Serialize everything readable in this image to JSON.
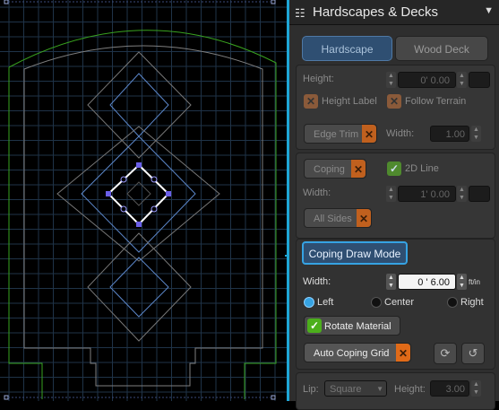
{
  "panel": {
    "title": "Hardscapes & Decks",
    "title_icon": "fence-icon",
    "collapse_icon": "chevron-down-icon",
    "tabs": [
      {
        "label": "Hardscape",
        "active": true
      },
      {
        "label": "Wood Deck",
        "active": false
      }
    ],
    "height_label": "Height:",
    "height_value": "0' 0.00",
    "height_label_toggle": "Height Label",
    "follow_terrain_toggle": "Follow Terrain",
    "edge_trim_label": "Edge Trim",
    "edge_width_label": "Width:",
    "edge_width_value": "1.00",
    "coping_label": "Coping",
    "line_2d_label": "2D Line",
    "coping_width_label": "Width:",
    "coping_width_value": "1' 0.00",
    "all_sides_label": "All Sides",
    "draw_mode_label": "Coping Draw Mode",
    "width_label": "Width:",
    "width_value": "0 ' 6.00",
    "unit_label": "ft/in",
    "align_options": [
      "Left",
      "Center",
      "Right"
    ],
    "align_selected": "Left",
    "rotate_material_label": "Rotate Material",
    "rotate_material_checked": true,
    "auto_coping_grid_label": "Auto Coping Grid",
    "refresh_icon": "refresh-icon",
    "undo_icon": "undo-icon",
    "lip_label": "Lip:",
    "lip_value": "Square",
    "lip_height_label": "Height:",
    "lip_height_value": "3.00"
  },
  "colors": {
    "accent": "#1ea6d6",
    "orange_x": "#c0601e",
    "check_green": "#4caf1c",
    "grid": "#1f3348",
    "outline_green": "#39a31f",
    "shape_blue": "#5b86c9",
    "handle_purple": "#6b5fe8"
  }
}
